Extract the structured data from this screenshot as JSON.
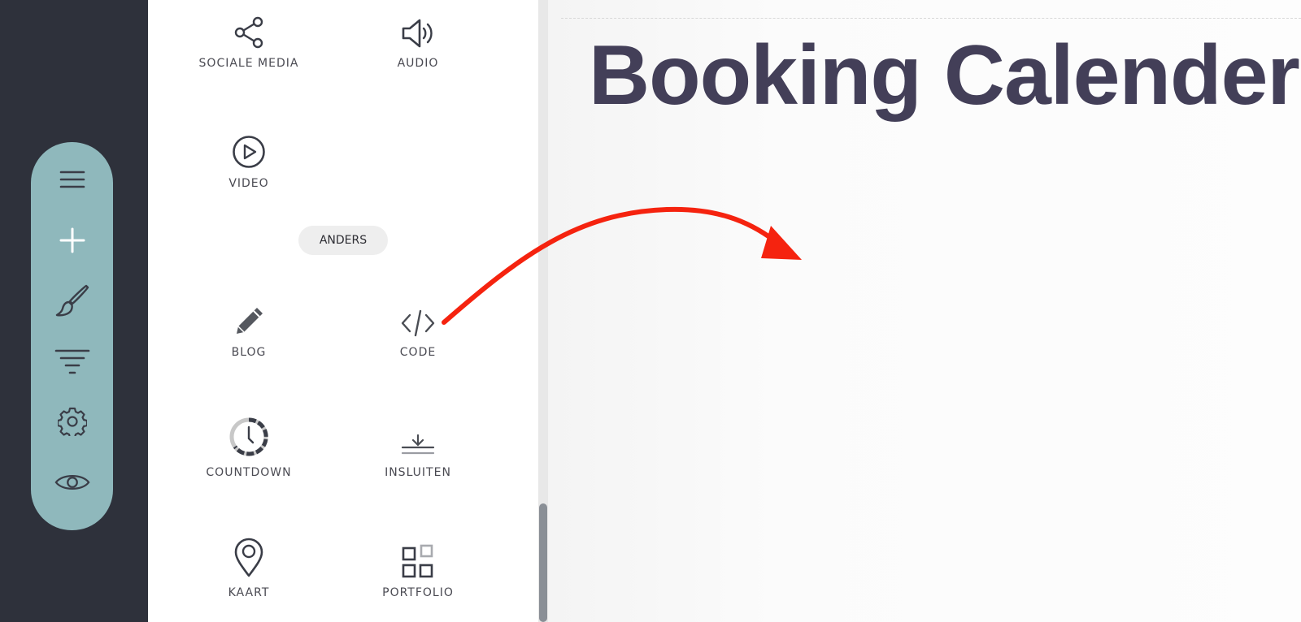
{
  "toolbar": {
    "items": [
      {
        "id": "menu",
        "icon": "menu-icon"
      },
      {
        "id": "add",
        "icon": "plus-icon"
      },
      {
        "id": "design",
        "icon": "brush-icon"
      },
      {
        "id": "filter",
        "icon": "filter-icon"
      },
      {
        "id": "settings",
        "icon": "gear-icon"
      },
      {
        "id": "preview",
        "icon": "eye-icon"
      }
    ],
    "colors": {
      "rail": "#2e313b",
      "pill": "#8fb8bc",
      "icon": "#3a3d47"
    }
  },
  "panel": {
    "widgets_top": [
      {
        "label": "SOCIALE MEDIA",
        "icon": "share-icon"
      },
      {
        "label": "AUDIO",
        "icon": "speaker-icon"
      },
      {
        "label": "VIDEO",
        "icon": "play-circle-icon"
      }
    ],
    "section_label": "ANDERS",
    "widgets_other": [
      {
        "label": "BLOG",
        "icon": "pencil-icon"
      },
      {
        "label": "CODE",
        "icon": "code-icon"
      },
      {
        "label": "COUNTDOWN",
        "icon": "countdown-clock-icon"
      },
      {
        "label": "INSLUITEN",
        "icon": "embed-download-icon"
      },
      {
        "label": "KAART",
        "icon": "map-pin-icon"
      },
      {
        "label": "PORTFOLIO",
        "icon": "portfolio-grid-icon"
      }
    ]
  },
  "canvas": {
    "heading": "Booking Calender",
    "heading_color": "#433f58"
  },
  "annotation": {
    "type": "arrow",
    "color": "#f5230f",
    "from_widget": "CODE"
  }
}
